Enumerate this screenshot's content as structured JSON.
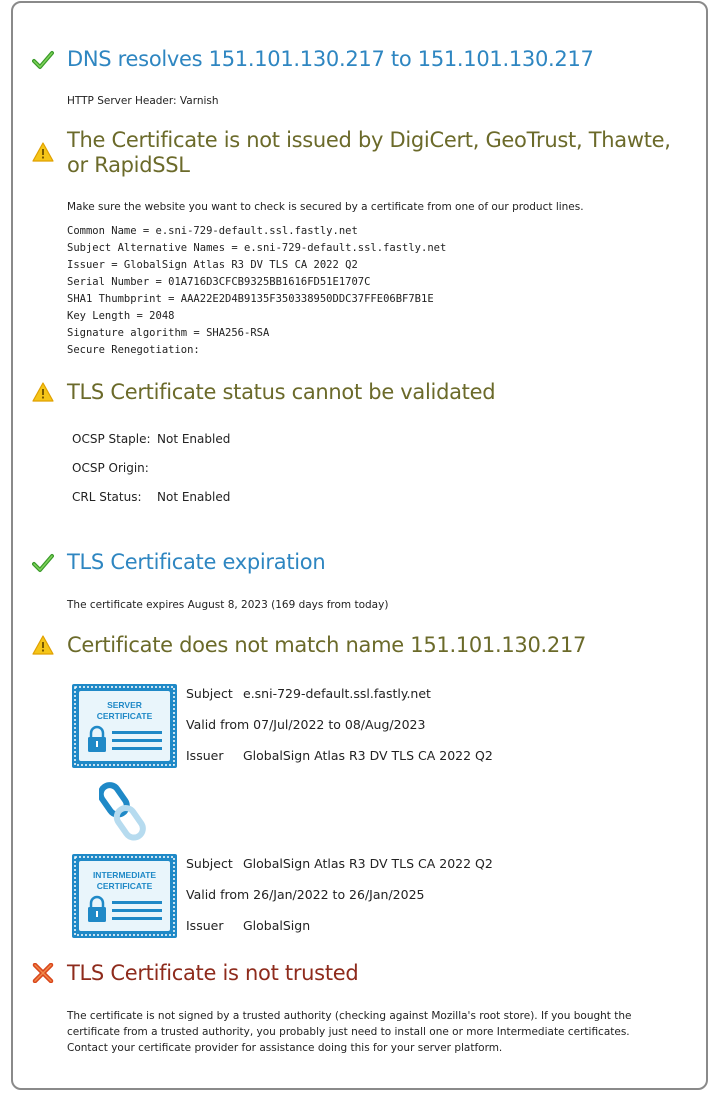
{
  "dns": {
    "heading": "DNS resolves 151.101.130.217 to 151.101.130.217",
    "server_header": "HTTP Server Header: Varnish"
  },
  "issuer_check": {
    "heading_line1": "The Certificate is not issued by DigiCert, GeoTrust, Thawte,",
    "heading_line2": "or RapidSSL",
    "note": "Make sure the website you want to check is secured by a certificate from one of our product lines.",
    "details": [
      "Common Name = e.sni-729-default.ssl.fastly.net",
      "Subject Alternative Names = e.sni-729-default.ssl.fastly.net",
      "Issuer = GlobalSign Atlas R3 DV TLS CA 2022 Q2",
      "Serial Number = 01A716D3CFCB9325BB1616FD51E1707C",
      "SHA1 Thumbprint = AAA22E2D4B9135F350338950DDC37FFE06BF7B1E",
      "Key Length = 2048",
      "Signature algorithm = SHA256-RSA",
      "Secure Renegotiation:"
    ]
  },
  "status": {
    "heading": "TLS Certificate status cannot be validated",
    "rows": [
      {
        "label": "OCSP Staple:",
        "value": "Not Enabled"
      },
      {
        "label": "OCSP Origin:",
        "value": ""
      },
      {
        "label": "CRL Status:",
        "value": "Not Enabled"
      }
    ]
  },
  "expiration": {
    "heading": "TLS Certificate expiration",
    "text": "The certificate expires August 8, 2023 (169 days from today)"
  },
  "name_match": {
    "heading": "Certificate does not match name 151.101.130.217",
    "server_cert": {
      "badge_line1": "SERVER",
      "badge_line2": "CERTIFICATE",
      "subject_label": "Subject",
      "subject_value": "e.sni-729-default.ssl.fastly.net",
      "valid": "Valid from 07/Jul/2022 to 08/Aug/2023",
      "issuer_label": "Issuer",
      "issuer_value": "GlobalSign Atlas R3 DV TLS CA 2022 Q2"
    },
    "intermediate_cert": {
      "badge_line1": "INTERMEDIATE",
      "badge_line2": "CERTIFICATE",
      "subject_label": "Subject",
      "subject_value": "GlobalSign Atlas R3 DV TLS CA 2022 Q2",
      "valid": "Valid from 26/Jan/2022 to 26/Jan/2025",
      "issuer_label": "Issuer",
      "issuer_value": "GlobalSign"
    }
  },
  "trust": {
    "heading": "TLS Certificate is not trusted",
    "text": "The certificate is not signed by a trusted authority (checking against Mozilla's root store). If you bought the certificate from a trusted authority, you probably just need to install one or more Intermediate certificates. Contact your certificate provider for assistance doing this for your server platform."
  },
  "colors": {
    "ok_heading": "#2e86c1",
    "warn_heading": "#6b6a2a",
    "error_heading": "#8e2b1c",
    "badge_blue": "#1f89c7"
  }
}
